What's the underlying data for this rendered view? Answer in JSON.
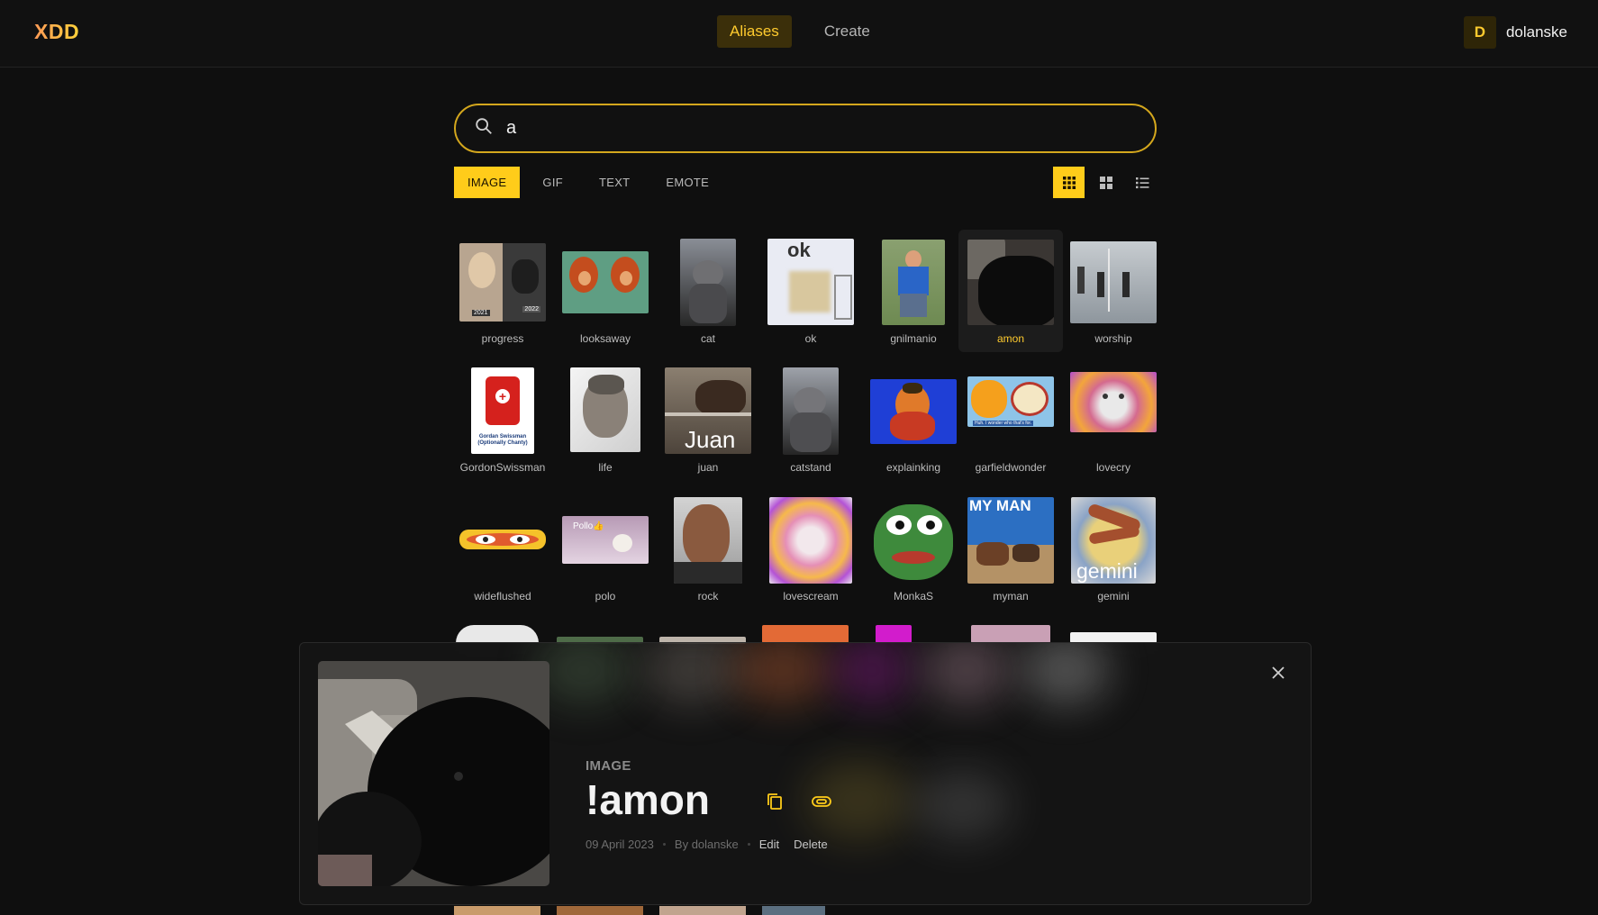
{
  "app": {
    "logo": "XDD"
  },
  "nav": {
    "items": [
      {
        "label": "Aliases",
        "active": true
      },
      {
        "label": "Create",
        "active": false
      }
    ]
  },
  "user": {
    "initial": "D",
    "name": "dolanske"
  },
  "search": {
    "value": "a",
    "icon": "search-icon"
  },
  "filters": [
    {
      "label": "IMAGE",
      "active": true
    },
    {
      "label": "GIF"
    },
    {
      "label": "TEXT"
    },
    {
      "label": "EMOTE"
    }
  ],
  "views": [
    {
      "icon": "small-grid-icon",
      "active": true
    },
    {
      "icon": "large-grid-icon"
    },
    {
      "icon": "list-icon"
    }
  ],
  "aliases": [
    {
      "label": "progress"
    },
    {
      "label": "looksaway"
    },
    {
      "label": "cat"
    },
    {
      "label": "ok"
    },
    {
      "label": "gnilmanio"
    },
    {
      "label": "amon",
      "selected": true
    },
    {
      "label": "worship"
    },
    {
      "label": "GordonSwissman"
    },
    {
      "label": "life"
    },
    {
      "label": "juan"
    },
    {
      "label": "catstand"
    },
    {
      "label": "explainking"
    },
    {
      "label": "garfieldwonder"
    },
    {
      "label": "lovecry"
    },
    {
      "label": "wideflushed"
    },
    {
      "label": "polo"
    },
    {
      "label": "rock"
    },
    {
      "label": "lovescream"
    },
    {
      "label": "MonkaS"
    },
    {
      "label": "myman"
    },
    {
      "label": "gemini"
    }
  ],
  "thumb_text": {
    "ok": "ok",
    "gordon_caption_1": "Gordan Swissman",
    "gordon_caption_2": "(Optionally Chanty)",
    "juan": "Juan",
    "garfield_caption": "Huh. I wonder who that's for.",
    "polo": "Pollo👍",
    "myman": "MY MAN",
    "gemini": "gemini",
    "progress_left": "2021",
    "progress_right": "2022"
  },
  "detail": {
    "type": "IMAGE",
    "name": "!amon",
    "date": "09 April 2023",
    "author": "By dolanske",
    "edit_label": "Edit",
    "delete_label": "Delete"
  },
  "colors": {
    "accent": "#ffcc1a",
    "background": "#0f0f0f"
  }
}
